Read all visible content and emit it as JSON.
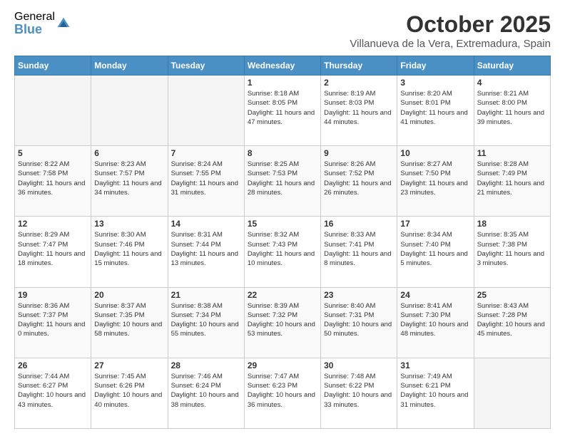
{
  "logo": {
    "general": "General",
    "blue": "Blue"
  },
  "title": "October 2025",
  "location": "Villanueva de la Vera, Extremadura, Spain",
  "headers": [
    "Sunday",
    "Monday",
    "Tuesday",
    "Wednesday",
    "Thursday",
    "Friday",
    "Saturday"
  ],
  "weeks": [
    [
      {
        "day": "",
        "info": ""
      },
      {
        "day": "",
        "info": ""
      },
      {
        "day": "",
        "info": ""
      },
      {
        "day": "1",
        "info": "Sunrise: 8:18 AM\nSunset: 8:05 PM\nDaylight: 11 hours and 47 minutes."
      },
      {
        "day": "2",
        "info": "Sunrise: 8:19 AM\nSunset: 8:03 PM\nDaylight: 11 hours and 44 minutes."
      },
      {
        "day": "3",
        "info": "Sunrise: 8:20 AM\nSunset: 8:01 PM\nDaylight: 11 hours and 41 minutes."
      },
      {
        "day": "4",
        "info": "Sunrise: 8:21 AM\nSunset: 8:00 PM\nDaylight: 11 hours and 39 minutes."
      }
    ],
    [
      {
        "day": "5",
        "info": "Sunrise: 8:22 AM\nSunset: 7:58 PM\nDaylight: 11 hours and 36 minutes."
      },
      {
        "day": "6",
        "info": "Sunrise: 8:23 AM\nSunset: 7:57 PM\nDaylight: 11 hours and 34 minutes."
      },
      {
        "day": "7",
        "info": "Sunrise: 8:24 AM\nSunset: 7:55 PM\nDaylight: 11 hours and 31 minutes."
      },
      {
        "day": "8",
        "info": "Sunrise: 8:25 AM\nSunset: 7:53 PM\nDaylight: 11 hours and 28 minutes."
      },
      {
        "day": "9",
        "info": "Sunrise: 8:26 AM\nSunset: 7:52 PM\nDaylight: 11 hours and 26 minutes."
      },
      {
        "day": "10",
        "info": "Sunrise: 8:27 AM\nSunset: 7:50 PM\nDaylight: 11 hours and 23 minutes."
      },
      {
        "day": "11",
        "info": "Sunrise: 8:28 AM\nSunset: 7:49 PM\nDaylight: 11 hours and 21 minutes."
      }
    ],
    [
      {
        "day": "12",
        "info": "Sunrise: 8:29 AM\nSunset: 7:47 PM\nDaylight: 11 hours and 18 minutes."
      },
      {
        "day": "13",
        "info": "Sunrise: 8:30 AM\nSunset: 7:46 PM\nDaylight: 11 hours and 15 minutes."
      },
      {
        "day": "14",
        "info": "Sunrise: 8:31 AM\nSunset: 7:44 PM\nDaylight: 11 hours and 13 minutes."
      },
      {
        "day": "15",
        "info": "Sunrise: 8:32 AM\nSunset: 7:43 PM\nDaylight: 11 hours and 10 minutes."
      },
      {
        "day": "16",
        "info": "Sunrise: 8:33 AM\nSunset: 7:41 PM\nDaylight: 11 hours and 8 minutes."
      },
      {
        "day": "17",
        "info": "Sunrise: 8:34 AM\nSunset: 7:40 PM\nDaylight: 11 hours and 5 minutes."
      },
      {
        "day": "18",
        "info": "Sunrise: 8:35 AM\nSunset: 7:38 PM\nDaylight: 11 hours and 3 minutes."
      }
    ],
    [
      {
        "day": "19",
        "info": "Sunrise: 8:36 AM\nSunset: 7:37 PM\nDaylight: 11 hours and 0 minutes."
      },
      {
        "day": "20",
        "info": "Sunrise: 8:37 AM\nSunset: 7:35 PM\nDaylight: 10 hours and 58 minutes."
      },
      {
        "day": "21",
        "info": "Sunrise: 8:38 AM\nSunset: 7:34 PM\nDaylight: 10 hours and 55 minutes."
      },
      {
        "day": "22",
        "info": "Sunrise: 8:39 AM\nSunset: 7:32 PM\nDaylight: 10 hours and 53 minutes."
      },
      {
        "day": "23",
        "info": "Sunrise: 8:40 AM\nSunset: 7:31 PM\nDaylight: 10 hours and 50 minutes."
      },
      {
        "day": "24",
        "info": "Sunrise: 8:41 AM\nSunset: 7:30 PM\nDaylight: 10 hours and 48 minutes."
      },
      {
        "day": "25",
        "info": "Sunrise: 8:43 AM\nSunset: 7:28 PM\nDaylight: 10 hours and 45 minutes."
      }
    ],
    [
      {
        "day": "26",
        "info": "Sunrise: 7:44 AM\nSunset: 6:27 PM\nDaylight: 10 hours and 43 minutes."
      },
      {
        "day": "27",
        "info": "Sunrise: 7:45 AM\nSunset: 6:26 PM\nDaylight: 10 hours and 40 minutes."
      },
      {
        "day": "28",
        "info": "Sunrise: 7:46 AM\nSunset: 6:24 PM\nDaylight: 10 hours and 38 minutes."
      },
      {
        "day": "29",
        "info": "Sunrise: 7:47 AM\nSunset: 6:23 PM\nDaylight: 10 hours and 36 minutes."
      },
      {
        "day": "30",
        "info": "Sunrise: 7:48 AM\nSunset: 6:22 PM\nDaylight: 10 hours and 33 minutes."
      },
      {
        "day": "31",
        "info": "Sunrise: 7:49 AM\nSunset: 6:21 PM\nDaylight: 10 hours and 31 minutes."
      },
      {
        "day": "",
        "info": ""
      }
    ]
  ]
}
